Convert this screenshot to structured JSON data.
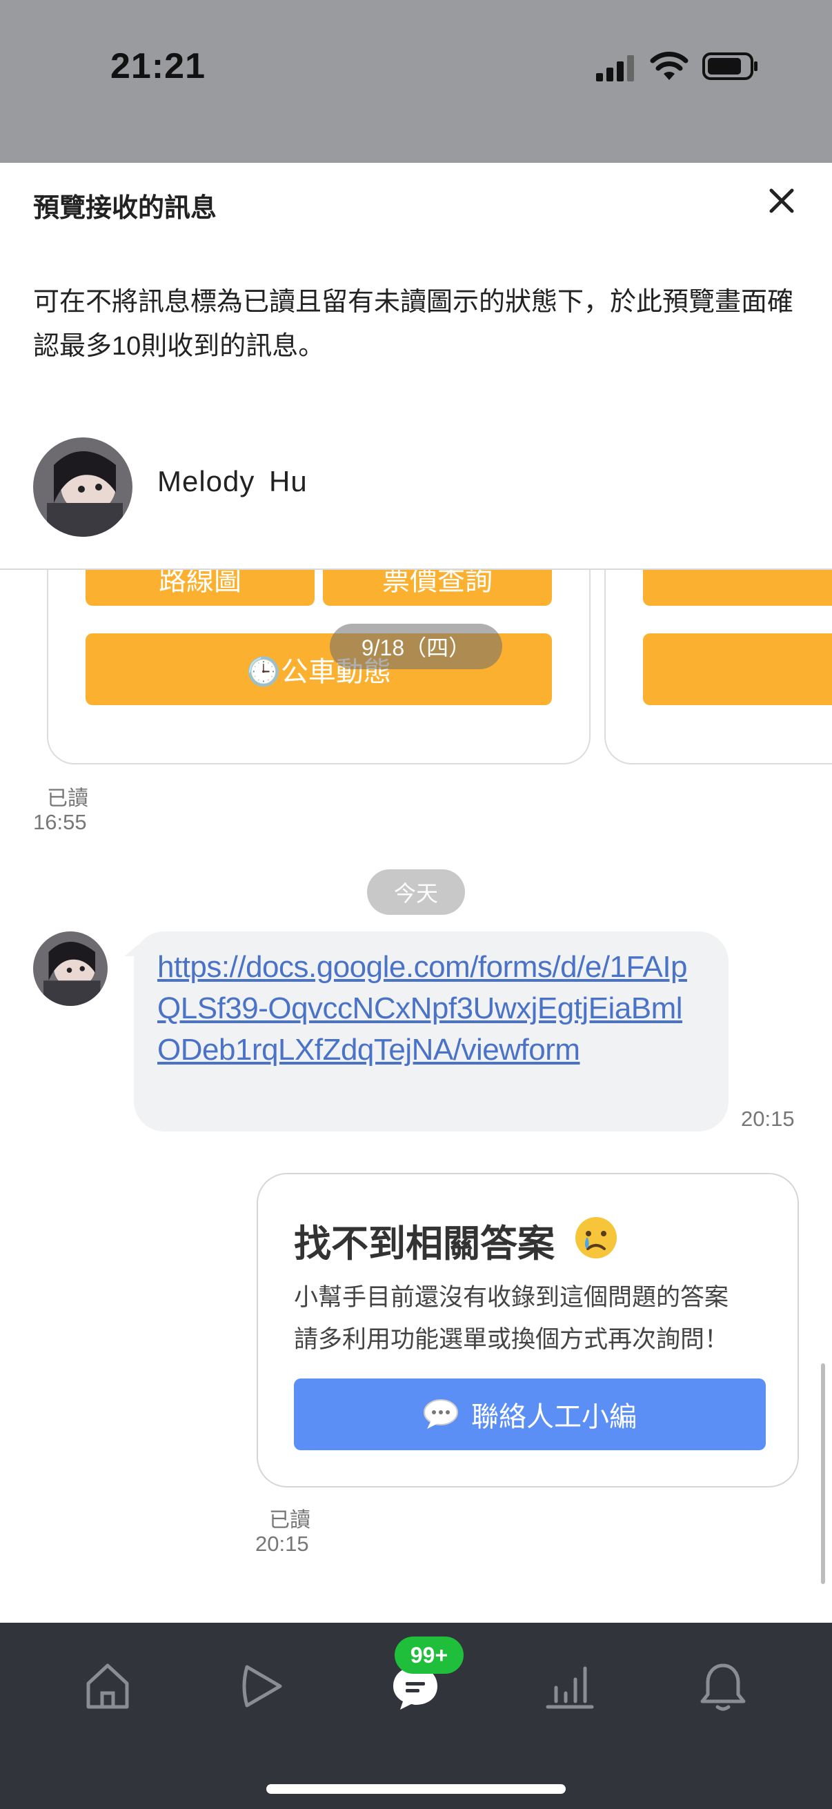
{
  "status_bar": {
    "time": "21:21"
  },
  "sheet": {
    "title": "預覽接收的訊息",
    "description": "可在不將訊息標為已讀且留有未讀圖示的狀態下，於此預覽畫面確認最多10則收到的訊息。",
    "sender_name": "Melody  Hu"
  },
  "chat": {
    "old_card": {
      "route_label": "路線圖",
      "fare_label": "票價查詢",
      "bus_label": "🕒公車動態"
    },
    "date_separator": "9/18（四）",
    "first_read": {
      "status": "已讀",
      "time": "16:55"
    },
    "today_separator": "今天",
    "incoming_link": {
      "text": "https://docs.google.com/forms/d/e/1FAIpQLSf39-OqvccNCxNpf3UwxjEgtjEiaBmlODeb1rqLXfZdqTejNA/viewform",
      "time": "20:15"
    },
    "reply_card": {
      "title": "找不到相關答案",
      "line1": "小幫手目前還沒有收錄到這個問題的答案",
      "line2": "請多利用功能選單或換個方式再次詢問！",
      "button_label": "聯絡人工小編"
    },
    "last_read": {
      "status": "已讀",
      "time": "20:15"
    }
  },
  "bottom_nav": {
    "badge": "99+",
    "items": [
      "home-icon",
      "play-icon",
      "chat-icon",
      "stats-icon",
      "bell-icon"
    ]
  },
  "colors": {
    "orange": "#fcb02f",
    "blue_button": "#5b8ff5",
    "link": "#4a72c7",
    "badge_green": "#1fbf3c",
    "nav_bg": "#31343a"
  }
}
